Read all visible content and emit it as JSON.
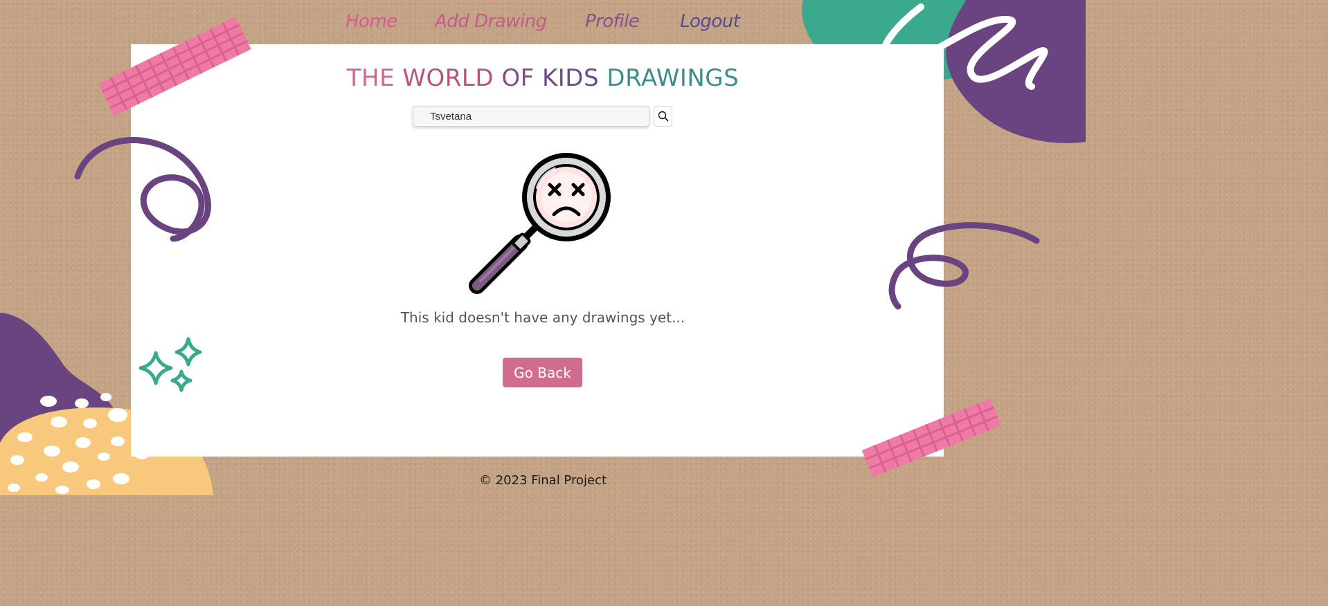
{
  "nav": {
    "home": "Home",
    "add_drawing": "Add Drawing",
    "profile": "Profile",
    "logout": "Logout"
  },
  "header": {
    "title_words": [
      "THE",
      "WORLD",
      "OF",
      "KIDS",
      "DRAWINGS"
    ],
    "title_colors": [
      "#d46690",
      "#b5557f",
      "#8a4a86",
      "#6b4a88",
      "#3f8c8a"
    ]
  },
  "search": {
    "value": "Tsvetana",
    "button_icon": "search-icon"
  },
  "empty_state": {
    "icon": "sad-magnifier-icon",
    "message": "This kid doesn't have any drawings yet..."
  },
  "actions": {
    "go_back": "Go Back"
  },
  "footer": {
    "text": "© 2023 Final Project"
  },
  "colors": {
    "accent_pink": "#d06d8e",
    "accent_purple": "#6a4481",
    "accent_teal": "#3aa98e",
    "accent_yellow": "#f8c97c",
    "background_kraft": "#c4a385"
  }
}
